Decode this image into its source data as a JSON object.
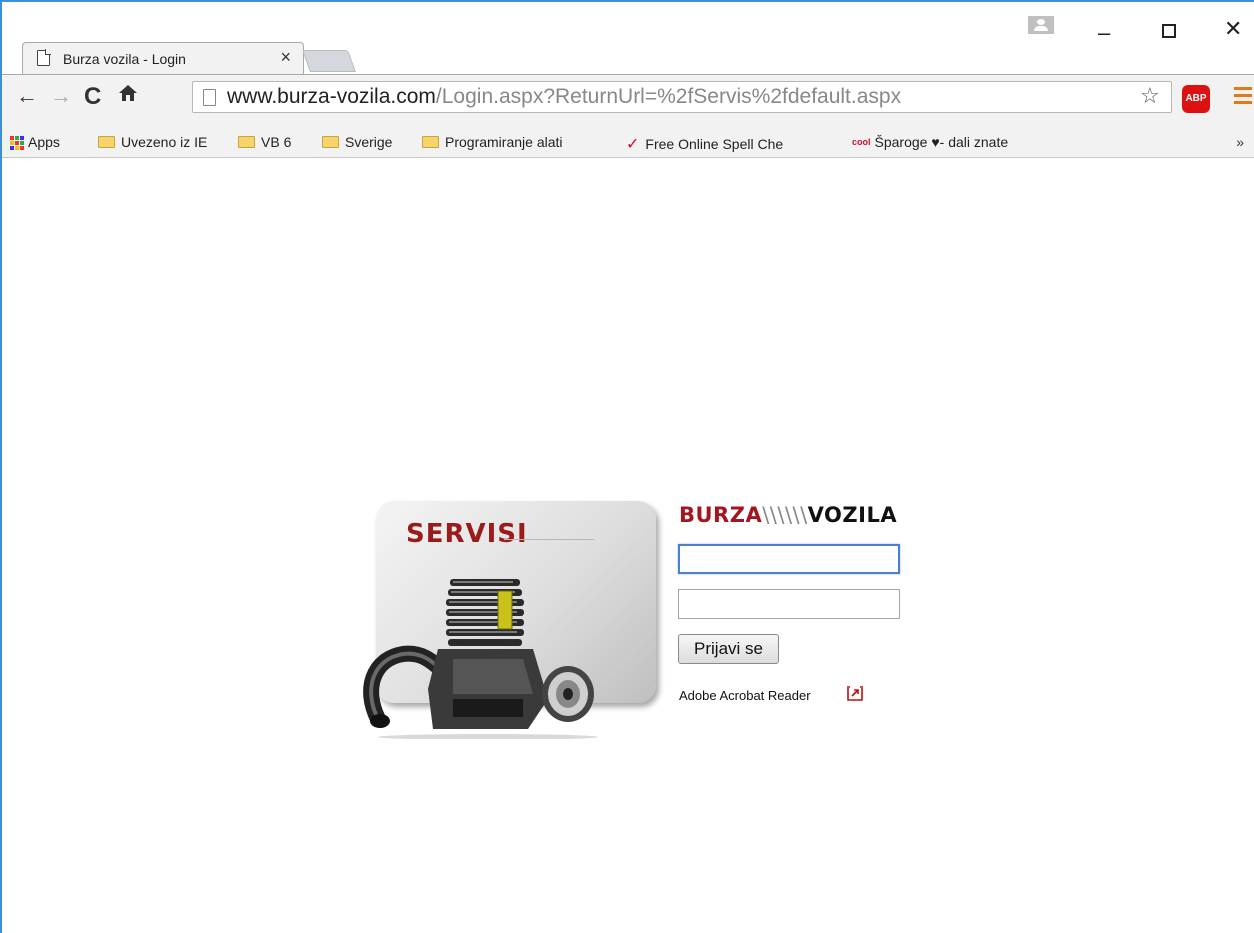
{
  "browser": {
    "tab": {
      "title": "Burza vozila - Login",
      "close": "×"
    },
    "window_controls": {
      "minimize": "–",
      "close": "✕"
    },
    "nav": {
      "back": "←",
      "forward": "→",
      "reload": "C",
      "home": "⌂"
    },
    "address": {
      "host": "www.burza-vozila.com",
      "path": "/Login.aspx?ReturnUrl=%2fServis%2fdefault.aspx"
    },
    "extensions": {
      "abp": "ABP",
      "star": "☆"
    },
    "bookmarks": [
      {
        "label": "Apps",
        "icon": "apps-icon"
      },
      {
        "label": "Uvezeno iz IE",
        "icon": "folder-icon"
      },
      {
        "label": "VB 6",
        "icon": "folder-icon"
      },
      {
        "label": "Sverige",
        "icon": "folder-icon"
      },
      {
        "label": "Programiranje alati",
        "icon": "folder-icon"
      },
      {
        "label": "Free Online Spell Che",
        "icon": "check-icon"
      },
      {
        "label": "Šparoge ♥- dali znate",
        "icon": "cool-icon",
        "badge": "cool"
      }
    ],
    "bookmarks_more": "»"
  },
  "page": {
    "card_title": "SERVISI",
    "brand": {
      "part1": "BURZA",
      "separator": "\\\\\\\\\\\\",
      "part2": "VOZILA"
    },
    "login": {
      "username_value": "",
      "password_value": "",
      "submit_label": "Prijavi se"
    },
    "acrobat_link": "Adobe Acrobat Reader"
  },
  "colors": {
    "brand_red": "#a31620",
    "focus_blue": "#4a7fd4",
    "window_border": "#3c8ed6"
  }
}
